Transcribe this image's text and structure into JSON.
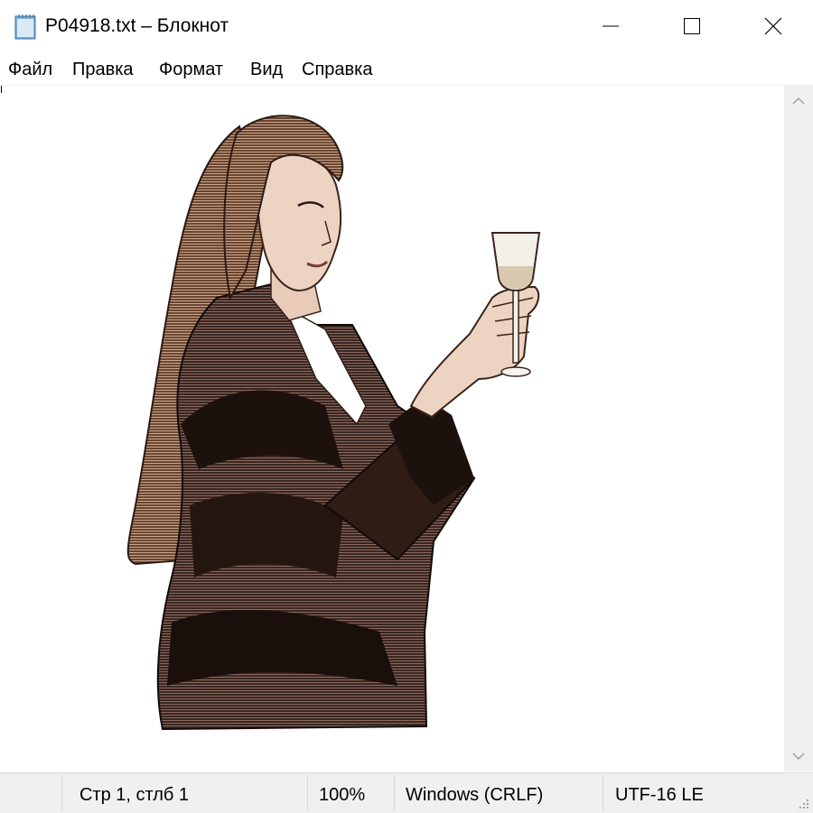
{
  "window": {
    "title": "P04918.txt – Блокнот",
    "icon": "notepad-icon"
  },
  "menu": {
    "items": [
      "Файл",
      "Правка",
      "Формат",
      "Вид",
      "Справка"
    ]
  },
  "document": {
    "content_image": "woman-raising-glass-illustration",
    "colors": {
      "jacket": "#2a1a14",
      "jacket_light": "#6b4f47",
      "skin": "#e8cbb8",
      "hair": "#5a3a26",
      "hair_light": "#c9a58d"
    }
  },
  "status": {
    "position": "Стр 1, стлб 1",
    "zoom": "100%",
    "line_endings": "Windows (CRLF)",
    "encoding": "UTF-16 LE"
  },
  "colors": {
    "chrome": "#f0f0f0",
    "separator": "#d7d7d7"
  }
}
